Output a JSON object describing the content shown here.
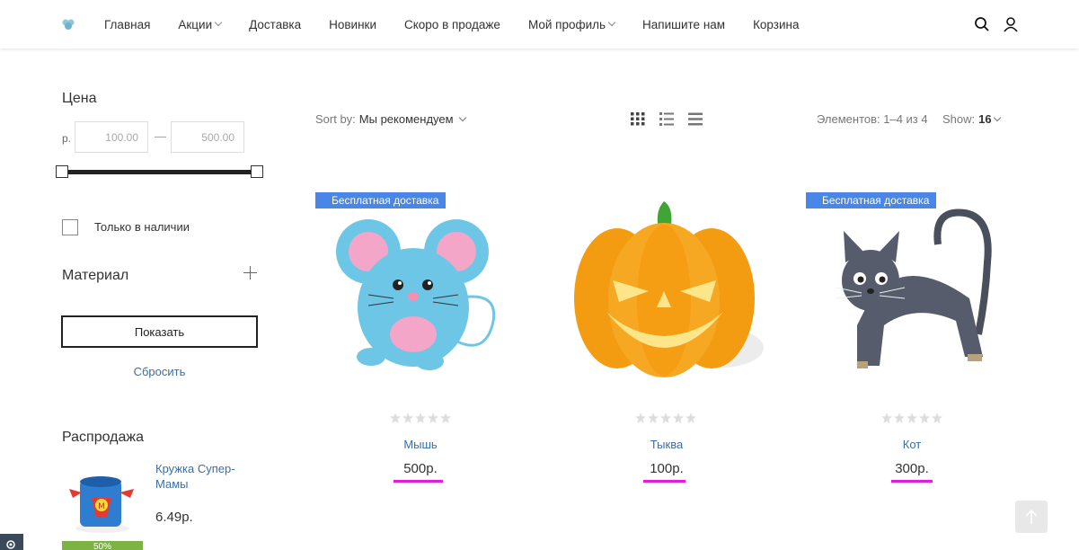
{
  "header": {
    "logo": "logo-icon",
    "nav": [
      {
        "label": "Главная",
        "has_dropdown": false
      },
      {
        "label": "Акции",
        "has_dropdown": true
      },
      {
        "label": "Доставка",
        "has_dropdown": false
      },
      {
        "label": "Новинки",
        "has_dropdown": false
      },
      {
        "label": "Скоро в продаже",
        "has_dropdown": false
      },
      {
        "label": "Мой профиль",
        "has_dropdown": true
      },
      {
        "label": "Напишите нам",
        "has_dropdown": false
      },
      {
        "label": "Корзина",
        "has_dropdown": false
      }
    ],
    "icons": [
      "search-icon",
      "user-icon"
    ]
  },
  "sidebar": {
    "price_title": "Цена",
    "currency": "р.",
    "price_from": "100.00",
    "price_to": "500.00",
    "price_dash": "—",
    "in_stock_label": "Только в наличии",
    "material_title": "Материал",
    "show_button": "Показать",
    "reset_link": "Сбросить",
    "sale_title": "Распродажа",
    "sale_item": {
      "name": "Кружка Супер-Мамы",
      "price": "6.49р.",
      "discount": "50%"
    }
  },
  "toolbar": {
    "sort_label": "Sort by:",
    "sort_value": "Мы рекомендуем",
    "views": [
      "grid-view-icon",
      "list-view-icon",
      "compact-list-icon"
    ],
    "count_text": "Элементов: 1–4 из 4",
    "show_label": "Show:",
    "show_value": "16"
  },
  "products": [
    {
      "name": "Мышь",
      "price": "500р.",
      "badge": "Бесплатная доставка",
      "rating": 0
    },
    {
      "name": "Тыква",
      "price": "100р.",
      "badge": "",
      "rating": 0
    },
    {
      "name": "Кот",
      "price": "300р.",
      "badge": "Бесплатная доставка",
      "rating": 0
    }
  ],
  "colors": {
    "badge": "#4a86e8",
    "link": "#3a6ea5",
    "highlight": "#e020d8",
    "sale_badge": "#7cb342"
  }
}
